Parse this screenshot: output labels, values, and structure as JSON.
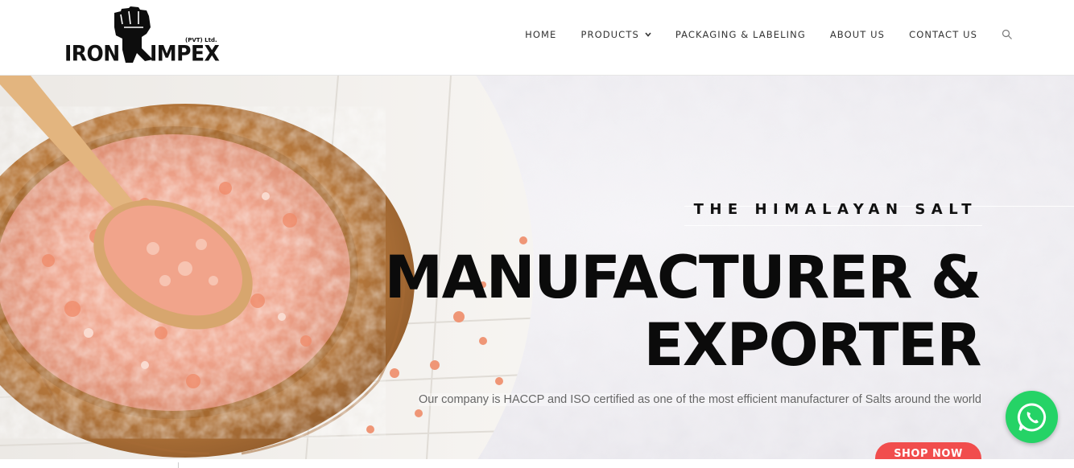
{
  "brand": {
    "name_left": "IRON",
    "name_right": "IMPEX",
    "suffix": "(PVT) Ltd."
  },
  "nav": {
    "items": [
      {
        "label": "HOME"
      },
      {
        "label": "PRODUCTS",
        "has_dropdown": true
      },
      {
        "label": "PACKAGING & LABELING"
      },
      {
        "label": "ABOUT US"
      },
      {
        "label": "CONTACT US"
      }
    ],
    "search_icon": "search-icon"
  },
  "hero": {
    "eyebrow": "THE HIMALAYAN SALT",
    "headline_line1": "MANUFACTURER &",
    "headline_line2": "EXPORTER",
    "subtitle": "Our company is HACCP and ISO certified as one of the most efficient manufacturer of Salts around the world",
    "cta_label": "SHOP NOW"
  },
  "colors": {
    "cta": "#f14d4d",
    "whatsapp": "#25d366",
    "text_dark": "#0b0b0b"
  },
  "floating": {
    "whatsapp_icon": "whatsapp-icon"
  }
}
